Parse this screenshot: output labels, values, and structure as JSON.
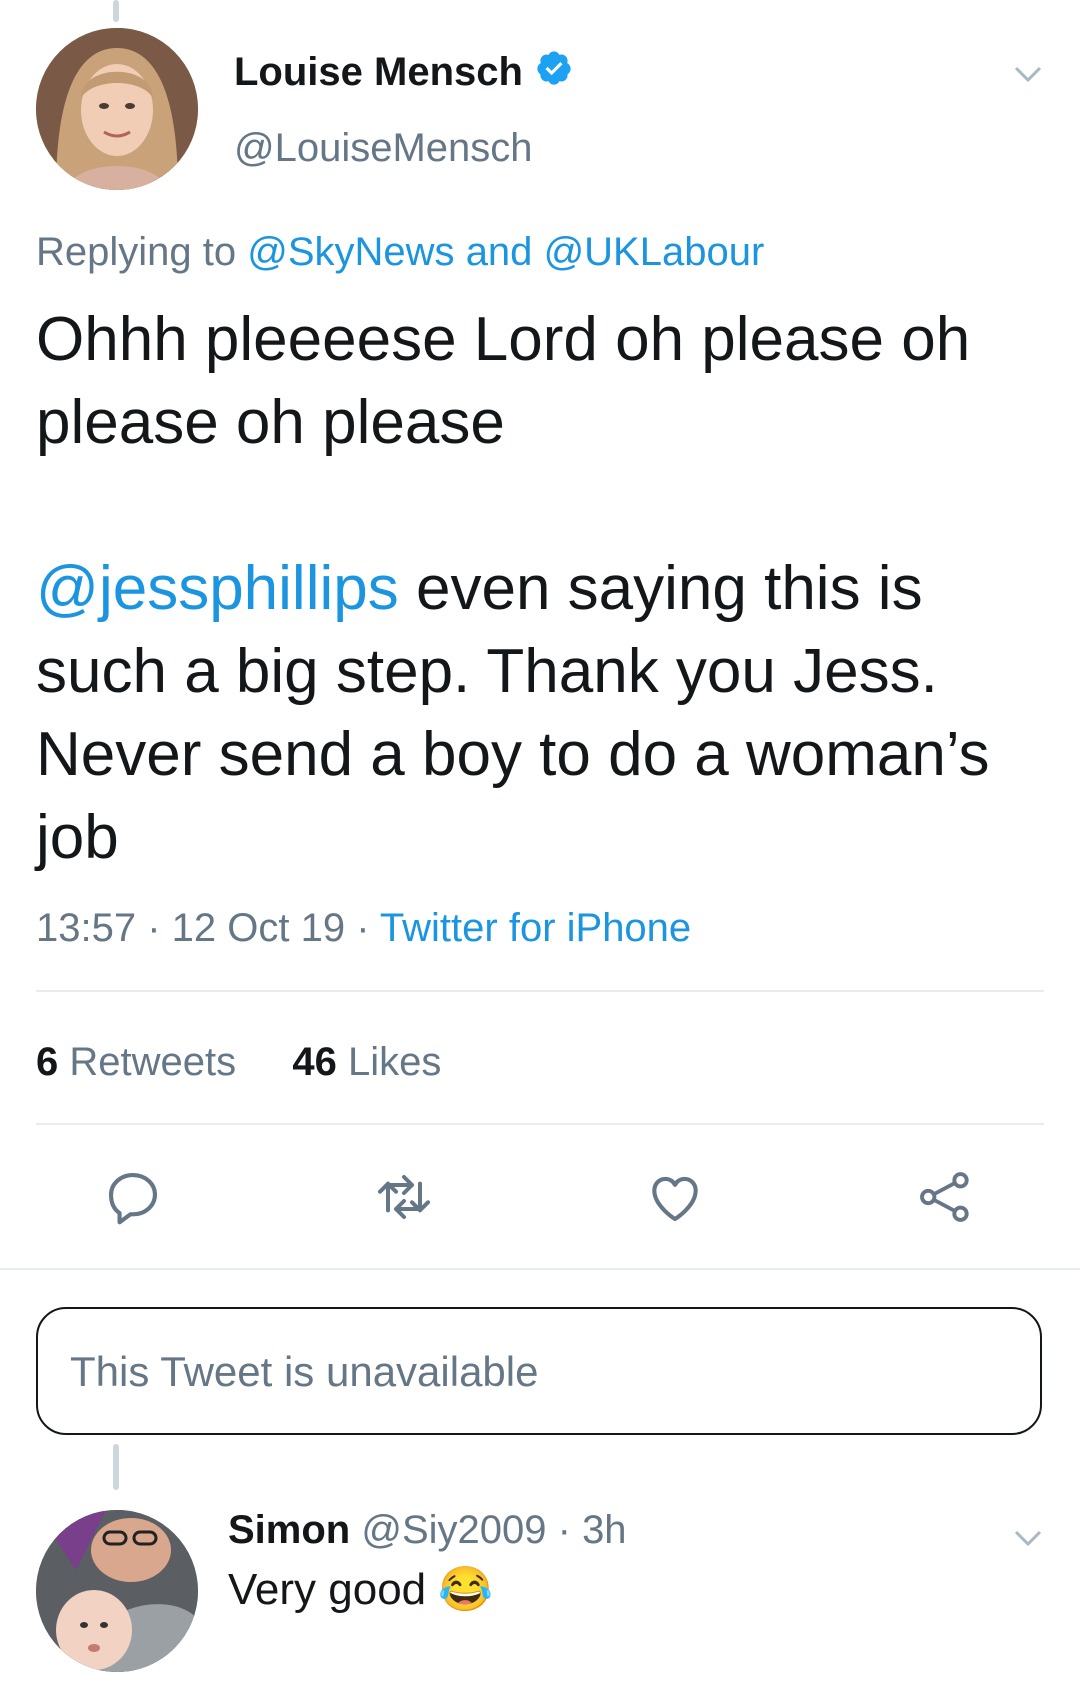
{
  "tweet": {
    "author_name": "Louise Mensch",
    "author_handle": "@LouiseMensch",
    "replying_prefix": "Replying to",
    "reply_to_1": "@SkyNews",
    "reply_and": "and",
    "reply_to_2": "@UKLabour",
    "text_line1": "Ohhh pleeeese Lord oh please oh please oh please",
    "mention": "@jessphillips",
    "text_line2": "even saying this is such a big step. Thank you Jess. Never send a boy to do a woman’s job",
    "time": "13:57",
    "date": "12 Oct 19",
    "source": "Twitter for iPhone",
    "retweets_count": "6",
    "retweets_label": "Retweets",
    "likes_count": "46",
    "likes_label": "Likes"
  },
  "actions": [
    "reply-icon",
    "retweet-icon",
    "like-icon",
    "share-icon"
  ],
  "unavailable": {
    "text": "This Tweet is unavailable"
  },
  "reply": {
    "author_name": "Simon",
    "author_handle": "@Siy2009",
    "time": "3h",
    "text": "Very good",
    "emoji": "😂"
  },
  "colors": {
    "link": "#1b95e0",
    "verified": "#1da1f2",
    "muted": "#657786",
    "text": "#14171a"
  }
}
